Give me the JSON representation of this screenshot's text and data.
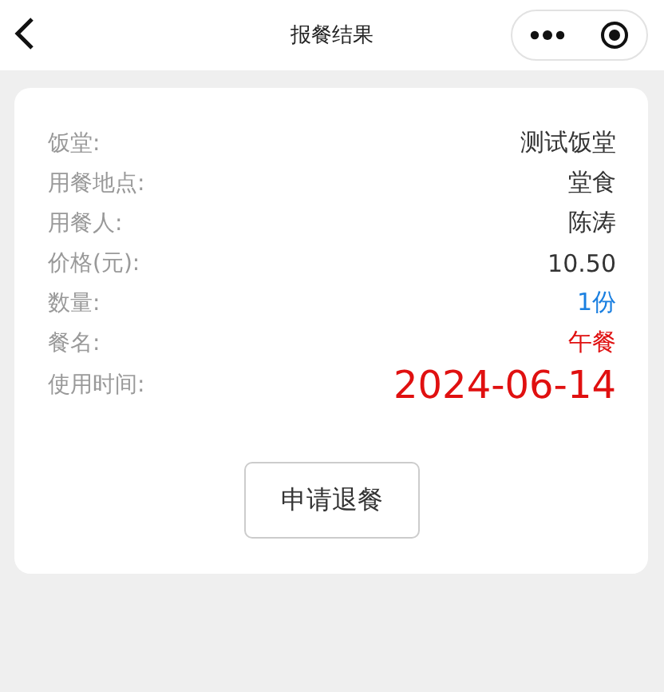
{
  "header": {
    "title": "报餐结果"
  },
  "rows": [
    {
      "label": "饭堂:",
      "value": "测试饭堂",
      "kind": "normal",
      "color": "#333333"
    },
    {
      "label": "用餐地点:",
      "value": "堂食",
      "kind": "normal",
      "color": "#333333"
    },
    {
      "label": "用餐人:",
      "value": "陈涛",
      "kind": "normal",
      "color": "#333333"
    },
    {
      "label": "价格(元):",
      "value": "10.50",
      "kind": "normal",
      "color": "#333333"
    },
    {
      "label": "数量:",
      "value": "1份",
      "kind": "normal",
      "color": "#1a7fe0"
    },
    {
      "label": "餐名:",
      "value": "午餐",
      "kind": "normal",
      "color": "#e01010"
    },
    {
      "label": "使用时间:",
      "value": "2024-06-14",
      "kind": "large",
      "color": "#e01010"
    }
  ],
  "button": "申请退餐"
}
